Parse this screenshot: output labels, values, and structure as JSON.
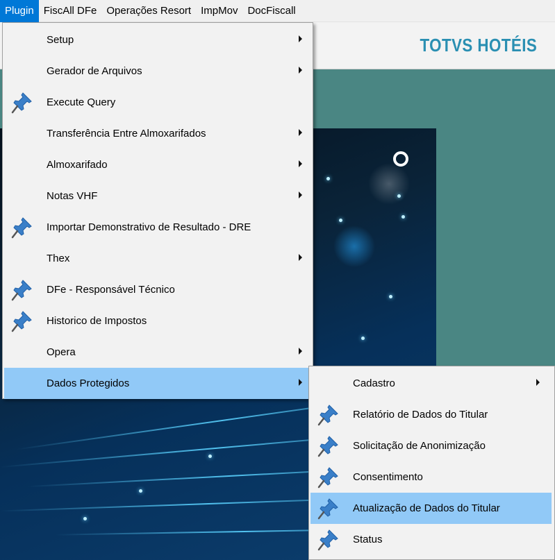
{
  "menubar": {
    "items": [
      {
        "label": "Plugin",
        "active": true
      },
      {
        "label": "FiscAll DFe"
      },
      {
        "label": "Operações Resort"
      },
      {
        "label": "ImpMov"
      },
      {
        "label": "DocFiscall"
      }
    ]
  },
  "header": {
    "brand": "TOTVS HOTÉIS"
  },
  "plugin_menu": {
    "items": [
      {
        "label": "Setup",
        "submenu": true,
        "pinned": false
      },
      {
        "label": "Gerador de Arquivos",
        "submenu": true,
        "pinned": false
      },
      {
        "label": "Execute Query",
        "submenu": false,
        "pinned": true
      },
      {
        "label": "Transferência Entre Almoxarifados",
        "submenu": true,
        "pinned": false
      },
      {
        "label": "Almoxarifado",
        "submenu": true,
        "pinned": false
      },
      {
        "label": "Notas VHF",
        "submenu": true,
        "pinned": false
      },
      {
        "label": "Importar Demonstrativo de Resultado - DRE",
        "submenu": false,
        "pinned": true
      },
      {
        "label": "Thex",
        "submenu": true,
        "pinned": false
      },
      {
        "label": "DFe - Responsável Técnico",
        "submenu": false,
        "pinned": true
      },
      {
        "label": "Historico de Impostos",
        "submenu": false,
        "pinned": true
      },
      {
        "label": "Opera",
        "submenu": true,
        "pinned": false
      },
      {
        "label": "Dados Protegidos",
        "submenu": true,
        "pinned": false,
        "highlighted": true
      }
    ]
  },
  "dados_protegidos_menu": {
    "items": [
      {
        "label": "Cadastro",
        "submenu": true,
        "pinned": false
      },
      {
        "label": "Relatório de Dados do Titular",
        "submenu": false,
        "pinned": true
      },
      {
        "label": "Solicitação de Anonimização",
        "submenu": false,
        "pinned": true
      },
      {
        "label": "Consentimento",
        "submenu": false,
        "pinned": true
      },
      {
        "label": "Atualização de Dados do Titular",
        "submenu": false,
        "pinned": true,
        "highlighted": true
      },
      {
        "label": "Status",
        "submenu": false,
        "pinned": true
      }
    ]
  },
  "colors": {
    "menubar_active": "#0078d7",
    "highlight": "#91c9f7",
    "brand": "#2a8fb2",
    "pin": "#3a7fc8",
    "desktop": "#4a8683"
  },
  "icons": {
    "pin": "pushpin-icon",
    "submenu": "submenu-arrow-icon"
  }
}
